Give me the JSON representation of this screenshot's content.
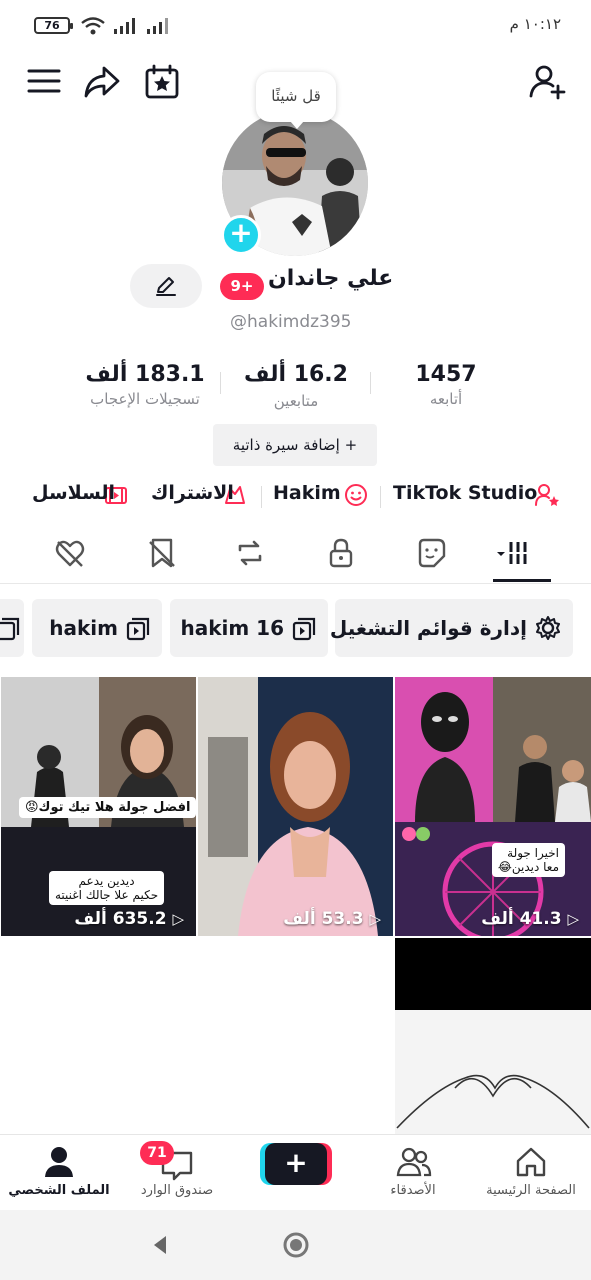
{
  "status_bar": {
    "battery": "76",
    "time": "١٠:١٢ م"
  },
  "bubble": {
    "text": "قل شيئًا"
  },
  "profile": {
    "name": "علي جاندان",
    "badge": "9+",
    "handle": "@hakimdz395",
    "bio_button": "+ إضافة سيرة ذاتية"
  },
  "stats": [
    {
      "value": "1457",
      "label": "أتابعه"
    },
    {
      "value": "16.2 ألف",
      "label": "متابعين"
    },
    {
      "value": "183.1 ألف",
      "label": "تسجيلات الإعجاب"
    }
  ],
  "links": {
    "studio": "TikTok Studio",
    "hakim": "Hakim",
    "subscription": "الاشتراك",
    "series": "السلاسل"
  },
  "playlists": {
    "manage": "إدارة قوائم التشغيل",
    "p1": "hakim 16",
    "p2": "hakim"
  },
  "videos": [
    {
      "views": "635.2 ألف",
      "caption1": "افضل جولة هلا تيك توك😡",
      "caption2": "ديدين يدعم",
      "caption3": "حكيم علا جالك اغنيته"
    },
    {
      "views": "53.3 ألف"
    },
    {
      "views": "41.3 ألف",
      "caption1": "اخيرا جولة",
      "caption2": "معا ديدين😂"
    }
  ],
  "nav": {
    "home": "الصفحة الرئيسية",
    "friends": "الأصدقاء",
    "inbox": "صندوق الوارد",
    "inbox_badge": "71",
    "profile": "الملف الشخصي"
  },
  "colors": {
    "accent": "#fe2c55",
    "cyan": "#20d5ec",
    "text": "#161823",
    "muted": "#8a8b91"
  }
}
